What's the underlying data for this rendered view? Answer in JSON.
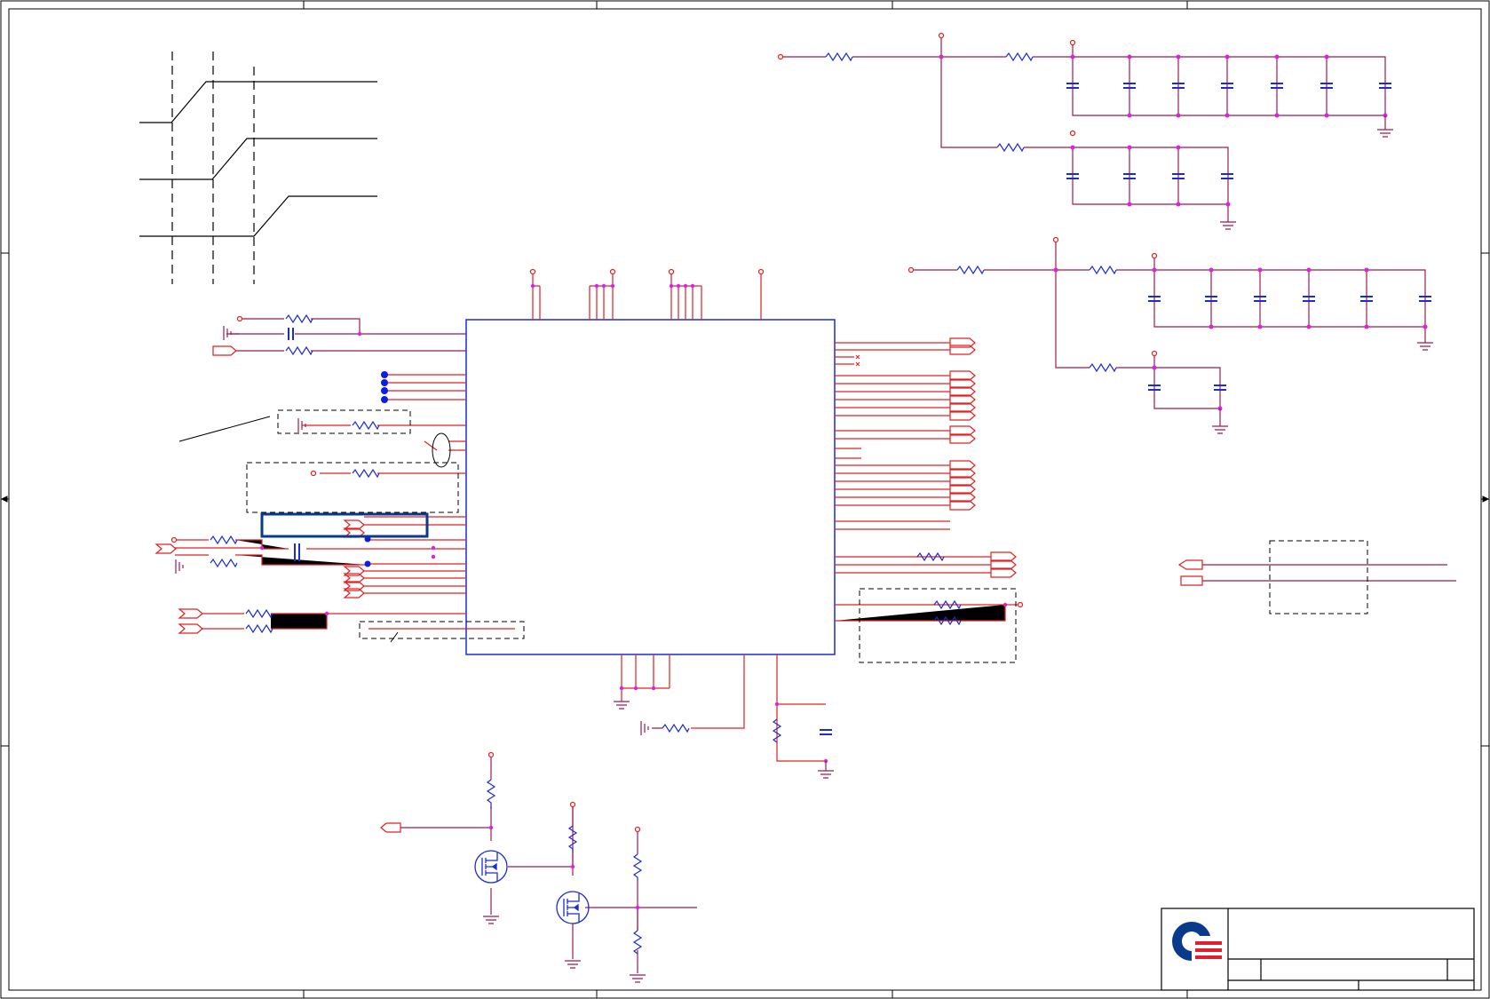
{
  "colors": {
    "frame": "#000000",
    "wire": "#9e1b4f",
    "net": "#e02020",
    "part": "#1a2bd8",
    "junction": "#e020e0",
    "bus_dot": "#0a1ee6",
    "highlight": "#0a3a8c",
    "logo_blue": "#0a3a8c",
    "logo_red": "#e02030"
  }
}
